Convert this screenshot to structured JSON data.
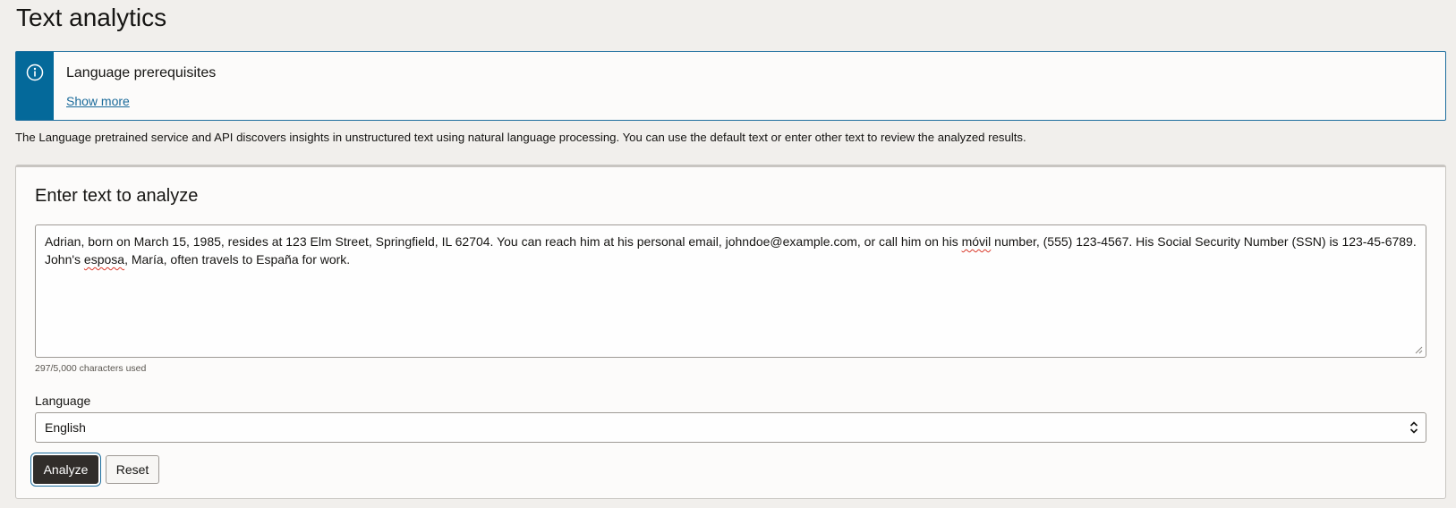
{
  "page": {
    "title": "Text analytics"
  },
  "banner": {
    "icon": "info-icon",
    "title": "Language prerequisites",
    "link": "Show more",
    "accent_color": "#04699a"
  },
  "description": "The Language pretrained service and API discovers insights in unstructured text using natural language processing. You can use the default text or enter other text to review the analyzed results.",
  "analyze_card": {
    "title": "Enter text to analyze",
    "text_value_line1": "Adrian, born on March 15, 1985, resides at 123 Elm Street, Springfield, IL 62704. You can reach him at his personal email, johndoe@example.com, or call him on his móvil number, (555) 123-4567. His Social Security Number (SSN) is 123-45-6789.",
    "text_value_line2": "John's esposa, María, often travels to España for work.",
    "char_count": "297/5,000 characters used",
    "language_label": "Language",
    "language_selected": "English",
    "analyze_label": "Analyze",
    "reset_label": "Reset",
    "primary_button_color": "#312d2a"
  }
}
